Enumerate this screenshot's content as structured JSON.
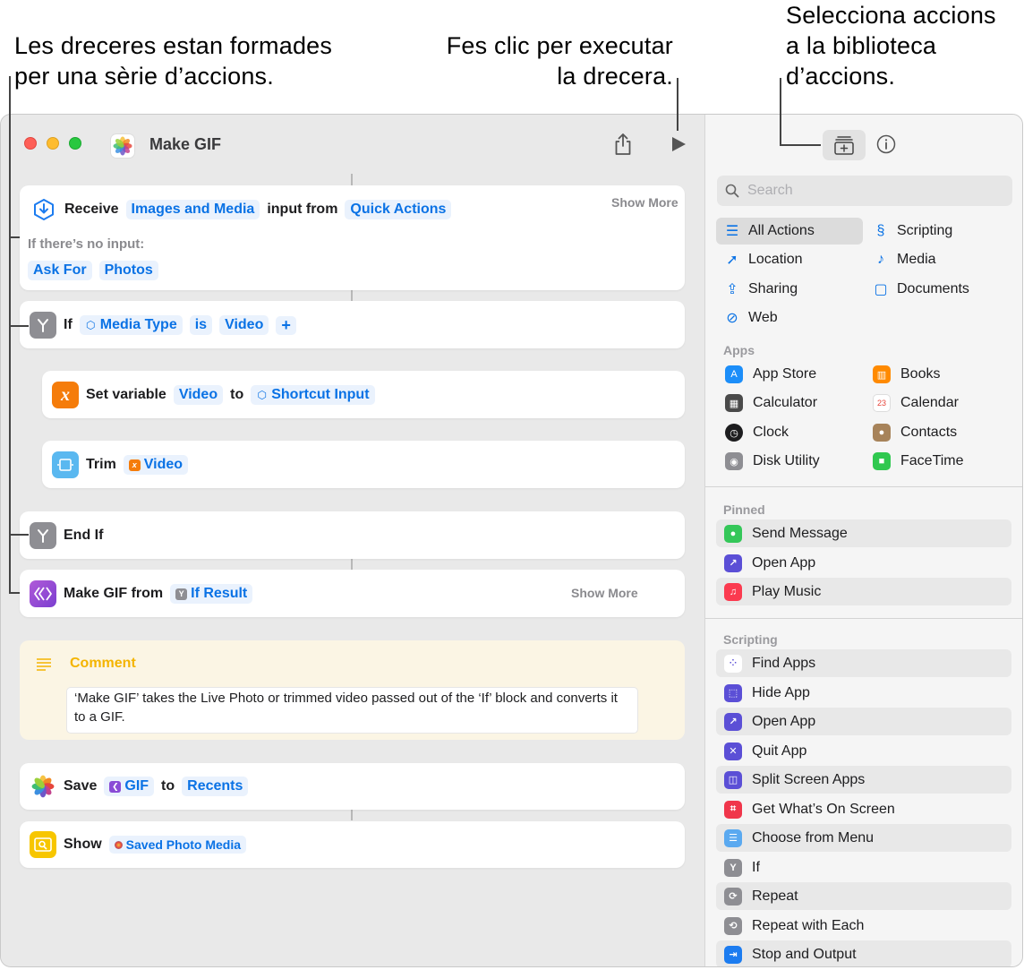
{
  "callouts": {
    "left": [
      "Les dreceres estan formades",
      "per una sèrie d’accions."
    ],
    "middle": [
      "Fes clic per executar",
      "la drecera."
    ],
    "right": [
      "Selecciona accions",
      "a la biblioteca",
      "d’accions."
    ]
  },
  "window": {
    "title": "Make GIF"
  },
  "editor": {
    "receive": {
      "label": "Receive",
      "token1": "Images and Media",
      "mid": "input from",
      "token2": "Quick Actions",
      "show_more": "Show More",
      "no_input": "If there’s no input:",
      "opt1": "Ask For",
      "opt2": "Photos"
    },
    "if": {
      "label": "If",
      "token1": "Media Type",
      "op": "is",
      "token2": "Video",
      "plus": "+"
    },
    "set_variable": {
      "label": "Set variable",
      "token1": "Video",
      "mid": "to",
      "token2": "Shortcut Input"
    },
    "trim": {
      "label": "Trim",
      "token1": "Video"
    },
    "end_if": {
      "label": "End If"
    },
    "make_gif": {
      "label": "Make GIF from",
      "token1": "If Result",
      "show_more": "Show More"
    },
    "comment": {
      "title": "Comment",
      "text": "‘Make GIF’ takes the Live Photo or trimmed video passed out of the ‘If’ block and converts it to a GIF."
    },
    "save": {
      "label": "Save",
      "token1": "GIF",
      "mid": "to",
      "token2": "Recents"
    },
    "show": {
      "label": "Show",
      "token1": "Saved Photo Media"
    }
  },
  "sidebar": {
    "search_placeholder": "Search",
    "categories": [
      {
        "label": "All Actions",
        "icon": "list-icon"
      },
      {
        "label": "Scripting",
        "icon": "scripting-icon"
      },
      {
        "label": "Location",
        "icon": "location-arrow-icon"
      },
      {
        "label": "Media",
        "icon": "music-note-icon"
      },
      {
        "label": "Sharing",
        "icon": "share-icon"
      },
      {
        "label": "Documents",
        "icon": "document-icon"
      },
      {
        "label": "Web",
        "icon": "compass-icon"
      }
    ],
    "apps_header": "Apps",
    "apps": [
      {
        "label": "App Store",
        "color": "#1c8ef9"
      },
      {
        "label": "Books",
        "color": "#ff8a00"
      },
      {
        "label": "Calculator",
        "color": "#4a4a4a"
      },
      {
        "label": "Calendar",
        "color": "#ffffff"
      },
      {
        "label": "Clock",
        "color": "#1d1d1f"
      },
      {
        "label": "Contacts",
        "color": "#a7835a"
      },
      {
        "label": "Disk Utility",
        "color": "#8e8e93"
      },
      {
        "label": "FaceTime",
        "color": "#2fc84f"
      }
    ],
    "pinned_header": "Pinned",
    "pinned": [
      {
        "label": "Send Message",
        "color": "#34c759"
      },
      {
        "label": "Open App",
        "color": "#5b4fd6"
      },
      {
        "label": "Play Music",
        "color": "#fb3a4f"
      }
    ],
    "scripting_header": "Scripting",
    "scripting": [
      {
        "label": "Find Apps",
        "color": "#ffffff"
      },
      {
        "label": "Hide App",
        "color": "#5b4fd6"
      },
      {
        "label": "Open App",
        "color": "#5b4fd6"
      },
      {
        "label": "Quit App",
        "color": "#5b4fd6"
      },
      {
        "label": "Split Screen Apps",
        "color": "#5b4fd6"
      },
      {
        "label": "Get What’s On Screen",
        "color": "#f0364b"
      },
      {
        "label": "Choose from Menu",
        "color": "#5aa9f0"
      },
      {
        "label": "If",
        "color": "#8e8e93"
      },
      {
        "label": "Repeat",
        "color": "#8e8e93"
      },
      {
        "label": "Repeat with Each",
        "color": "#8e8e93"
      },
      {
        "label": "Stop and Output",
        "color": "#1c7cf0"
      }
    ]
  }
}
